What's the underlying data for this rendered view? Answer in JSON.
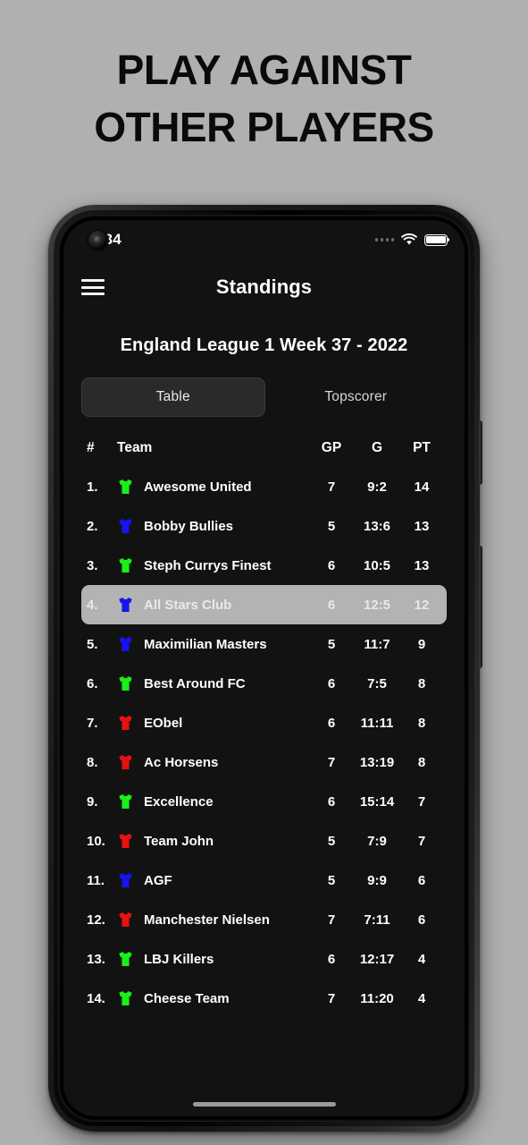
{
  "promo": {
    "line1": "PLAY AGAINST",
    "line2": "OTHER PLAYERS"
  },
  "statusbar": {
    "time": "0.34",
    "signal_icon": "signal-dots-icon",
    "wifi_icon": "wifi-icon",
    "battery_icon": "battery-full-icon"
  },
  "appbar": {
    "menu_icon": "hamburger-menu-icon",
    "title": "Standings"
  },
  "league_title": "England League 1 Week 37 - 2022",
  "tabs": [
    {
      "label": "Table",
      "active": true
    },
    {
      "label": "Topscorer",
      "active": false
    }
  ],
  "table": {
    "headers": {
      "rank": "#",
      "team": "Team",
      "gp": "GP",
      "g": "G",
      "pt": "PT"
    },
    "rows": [
      {
        "rank": "1.",
        "jersey": "#1aef1a",
        "team": "Awesome United",
        "gp": "7",
        "g": "9:2",
        "pt": "14",
        "highlight": false
      },
      {
        "rank": "2.",
        "jersey": "#1414f0",
        "team": "Bobby Bullies",
        "gp": "5",
        "g": "13:6",
        "pt": "13",
        "highlight": false
      },
      {
        "rank": "3.",
        "jersey": "#1aef1a",
        "team": "Steph Currys Finest",
        "gp": "6",
        "g": "10:5",
        "pt": "13",
        "highlight": false
      },
      {
        "rank": "4.",
        "jersey": "#1414f0",
        "team": "All Stars Club",
        "gp": "6",
        "g": "12:5",
        "pt": "12",
        "highlight": true
      },
      {
        "rank": "5.",
        "jersey": "#1414f0",
        "team": "Maximilian Masters",
        "gp": "5",
        "g": "11:7",
        "pt": "9",
        "highlight": false
      },
      {
        "rank": "6.",
        "jersey": "#1aef1a",
        "team": "Best Around FC",
        "gp": "6",
        "g": "7:5",
        "pt": "8",
        "highlight": false
      },
      {
        "rank": "7.",
        "jersey": "#e81111",
        "team": "EObel",
        "gp": "6",
        "g": "11:11",
        "pt": "8",
        "highlight": false
      },
      {
        "rank": "8.",
        "jersey": "#e81111",
        "team": "Ac Horsens",
        "gp": "7",
        "g": "13:19",
        "pt": "8",
        "highlight": false
      },
      {
        "rank": "9.",
        "jersey": "#1aef1a",
        "team": "Excellence",
        "gp": "6",
        "g": "15:14",
        "pt": "7",
        "highlight": false
      },
      {
        "rank": "10.",
        "jersey": "#e81111",
        "team": "Team John",
        "gp": "5",
        "g": "7:9",
        "pt": "7",
        "highlight": false
      },
      {
        "rank": "11.",
        "jersey": "#1414f0",
        "team": "AGF",
        "gp": "5",
        "g": "9:9",
        "pt": "6",
        "highlight": false
      },
      {
        "rank": "12.",
        "jersey": "#e81111",
        "team": "Manchester Nielsen",
        "gp": "7",
        "g": "7:11",
        "pt": "6",
        "highlight": false
      },
      {
        "rank": "13.",
        "jersey": "#1aef1a",
        "team": "LBJ Killers",
        "gp": "6",
        "g": "12:17",
        "pt": "4",
        "highlight": false
      },
      {
        "rank": "14.",
        "jersey": "#1aef1a",
        "team": "Cheese Team",
        "gp": "7",
        "g": "11:20",
        "pt": "4",
        "highlight": false
      }
    ]
  },
  "home_indicator": "home-indicator"
}
